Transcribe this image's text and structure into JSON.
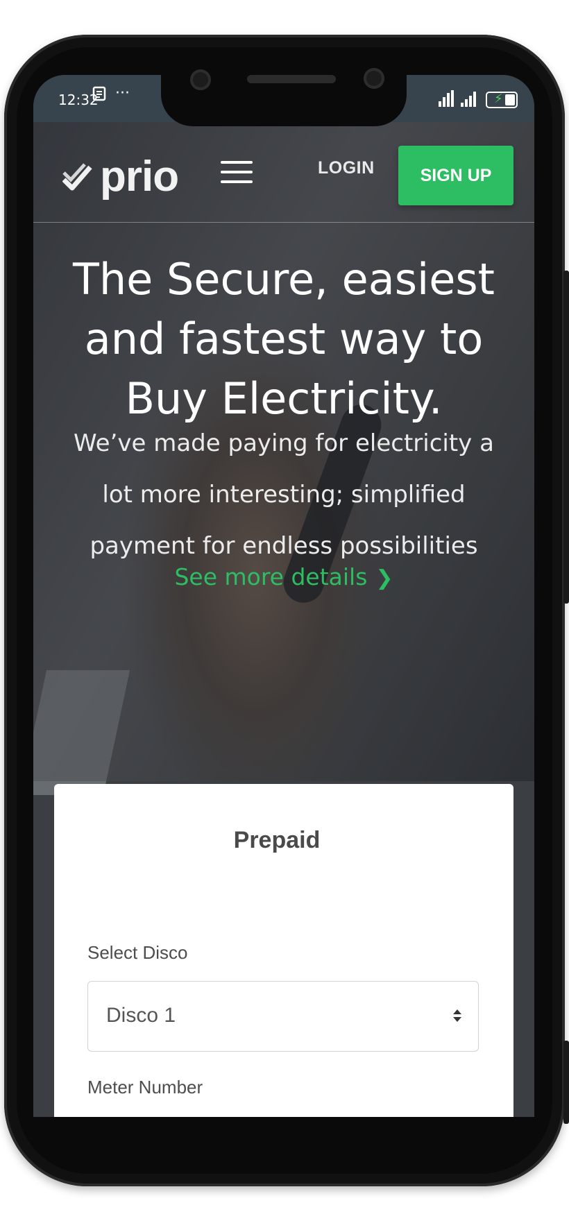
{
  "status_bar": {
    "time": "12:32",
    "notification_icon": "document-notification-icon",
    "more": "···"
  },
  "header": {
    "logo_text": "prio",
    "login_label": "LOGIN",
    "signup_label": "SIGN UP"
  },
  "hero": {
    "headline": "The Secure, easiest and fastest way to Buy Electricity.",
    "subtext": "We’ve made paying for electricity a lot more interesting; simplified payment for endless possibilities",
    "cta_label": "See more details"
  },
  "form": {
    "title": "Prepaid",
    "disco_label": "Select Disco",
    "disco_value": "Disco 1",
    "meter_label": "Meter Number",
    "meter_value": ""
  },
  "colors": {
    "accent": "#2dbd63",
    "status_bar": "#37444d"
  }
}
